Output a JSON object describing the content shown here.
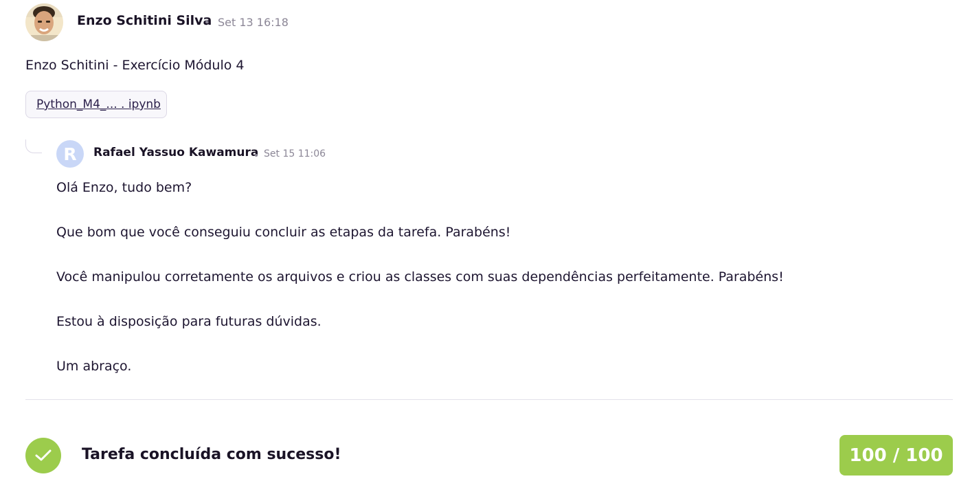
{
  "post": {
    "author": "Enzo Schitini Silva",
    "date": "Set 13 16:18",
    "body": "Enzo Schitini - Exercício Módulo 4",
    "attachment_label": "Python_M4_... . ipynb"
  },
  "reply": {
    "avatar_initial": "R",
    "author": "Rafael Yassuo Kawamura",
    "date": "Set 15 11:06",
    "lines": [
      "Olá Enzo, tudo bem?",
      "Que bom que você conseguiu concluir as etapas da tarefa. Parabéns!",
      "Você manipulou corretamente os arquivos e criou as classes com suas dependências perfeitamente. Parabéns!",
      "Estou à disposição para futuras dúvidas.",
      "Um abraço."
    ]
  },
  "status": {
    "message": "Tarefa concluída com sucesso!",
    "score": "100 / 100",
    "icon": "check-icon"
  },
  "colors": {
    "success": "#9ccc4c",
    "reply_avatar": "#c9d7f7",
    "text": "#1d1530",
    "muted": "#8b8696"
  }
}
